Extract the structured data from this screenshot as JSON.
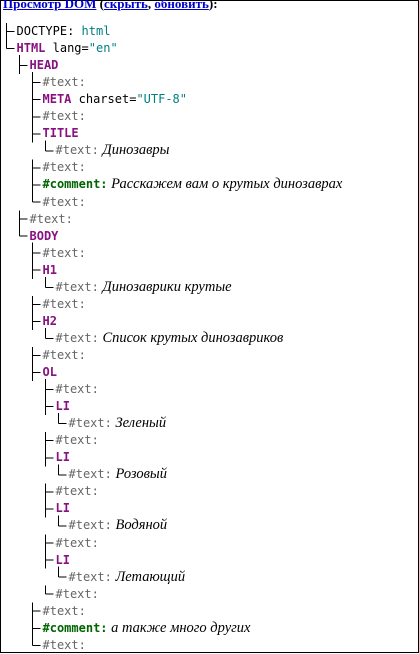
{
  "header": {
    "title": "Просмотр DOM",
    "open_paren": "(",
    "hide_link": "скрыть",
    "comma": ",",
    "refresh_link": "обновить",
    "close_paren": "):"
  },
  "tree": [
    {
      "depth": 0,
      "last": false,
      "parts": [
        {
          "t": "DOCTYPE: ",
          "c": "plain"
        },
        {
          "t": "html",
          "c": "val"
        }
      ]
    },
    {
      "depth": 0,
      "last": true,
      "parts": [
        {
          "t": "HTML",
          "c": "tag"
        },
        {
          "t": " lang=",
          "c": "plain"
        },
        {
          "t": "\"en\"",
          "c": "val"
        }
      ]
    },
    {
      "depth": 1,
      "last": false,
      "parts": [
        {
          "t": "HEAD",
          "c": "tag"
        }
      ]
    },
    {
      "depth": 2,
      "last": false,
      "parts": [
        {
          "t": "#text:",
          "c": "txt"
        }
      ]
    },
    {
      "depth": 2,
      "last": false,
      "parts": [
        {
          "t": "META",
          "c": "tag"
        },
        {
          "t": " charset=",
          "c": "plain"
        },
        {
          "t": "\"UTF-8\"",
          "c": "val"
        }
      ]
    },
    {
      "depth": 2,
      "last": false,
      "parts": [
        {
          "t": "#text:",
          "c": "txt"
        }
      ]
    },
    {
      "depth": 2,
      "last": false,
      "parts": [
        {
          "t": "TITLE",
          "c": "tag"
        }
      ]
    },
    {
      "depth": 3,
      "last": true,
      "parts": [
        {
          "t": "#text:",
          "c": "txt"
        },
        {
          "t": " Динозавры",
          "c": "italic"
        }
      ]
    },
    {
      "depth": 2,
      "last": false,
      "parts": [
        {
          "t": "#text:",
          "c": "txt"
        }
      ]
    },
    {
      "depth": 2,
      "last": false,
      "parts": [
        {
          "t": "#comment:",
          "c": "cmt"
        },
        {
          "t": "  Расскажем вам о крутых динозаврах",
          "c": "italic"
        }
      ]
    },
    {
      "depth": 2,
      "last": true,
      "parts": [
        {
          "t": "#text:",
          "c": "txt"
        }
      ]
    },
    {
      "depth": 1,
      "last": false,
      "parts": [
        {
          "t": "#text:",
          "c": "txt"
        }
      ]
    },
    {
      "depth": 1,
      "last": true,
      "parts": [
        {
          "t": "BODY",
          "c": "tag"
        }
      ]
    },
    {
      "depth": 2,
      "last": false,
      "parts": [
        {
          "t": "#text:",
          "c": "txt"
        }
      ]
    },
    {
      "depth": 2,
      "last": false,
      "parts": [
        {
          "t": "H1",
          "c": "tag"
        }
      ]
    },
    {
      "depth": 3,
      "last": true,
      "parts": [
        {
          "t": "#text:",
          "c": "txt"
        },
        {
          "t": " Динозаврики крутые",
          "c": "italic"
        }
      ]
    },
    {
      "depth": 2,
      "last": false,
      "parts": [
        {
          "t": "#text:",
          "c": "txt"
        }
      ]
    },
    {
      "depth": 2,
      "last": false,
      "parts": [
        {
          "t": "H2",
          "c": "tag"
        }
      ]
    },
    {
      "depth": 3,
      "last": true,
      "parts": [
        {
          "t": "#text:",
          "c": "txt"
        },
        {
          "t": " Список крутых динозавриков",
          "c": "italic"
        }
      ]
    },
    {
      "depth": 2,
      "last": false,
      "parts": [
        {
          "t": "#text:",
          "c": "txt"
        }
      ]
    },
    {
      "depth": 2,
      "last": false,
      "parts": [
        {
          "t": "OL",
          "c": "tag"
        }
      ]
    },
    {
      "depth": 3,
      "last": false,
      "parts": [
        {
          "t": "#text:",
          "c": "txt"
        }
      ]
    },
    {
      "depth": 3,
      "last": false,
      "parts": [
        {
          "t": "LI",
          "c": "tag"
        }
      ]
    },
    {
      "depth": 4,
      "last": true,
      "parts": [
        {
          "t": "#text:",
          "c": "txt"
        },
        {
          "t": " Зеленый",
          "c": "italic"
        }
      ]
    },
    {
      "depth": 3,
      "last": false,
      "parts": [
        {
          "t": "#text:",
          "c": "txt"
        }
      ]
    },
    {
      "depth": 3,
      "last": false,
      "parts": [
        {
          "t": "LI",
          "c": "tag"
        }
      ]
    },
    {
      "depth": 4,
      "last": true,
      "parts": [
        {
          "t": "#text:",
          "c": "txt"
        },
        {
          "t": " Розовый",
          "c": "italic"
        }
      ]
    },
    {
      "depth": 3,
      "last": false,
      "parts": [
        {
          "t": "#text:",
          "c": "txt"
        }
      ]
    },
    {
      "depth": 3,
      "last": false,
      "parts": [
        {
          "t": "LI",
          "c": "tag"
        }
      ]
    },
    {
      "depth": 4,
      "last": true,
      "parts": [
        {
          "t": "#text:",
          "c": "txt"
        },
        {
          "t": " Водяной",
          "c": "italic"
        }
      ]
    },
    {
      "depth": 3,
      "last": false,
      "parts": [
        {
          "t": "#text:",
          "c": "txt"
        }
      ]
    },
    {
      "depth": 3,
      "last": false,
      "parts": [
        {
          "t": "LI",
          "c": "tag"
        }
      ]
    },
    {
      "depth": 4,
      "last": true,
      "parts": [
        {
          "t": "#text:",
          "c": "txt"
        },
        {
          "t": " Летающий",
          "c": "italic"
        }
      ]
    },
    {
      "depth": 3,
      "last": true,
      "parts": [
        {
          "t": "#text:",
          "c": "txt"
        }
      ]
    },
    {
      "depth": 2,
      "last": false,
      "parts": [
        {
          "t": "#text:",
          "c": "txt"
        }
      ]
    },
    {
      "depth": 2,
      "last": false,
      "parts": [
        {
          "t": "#comment:",
          "c": "cmt"
        },
        {
          "t": "  а также много других",
          "c": "italic"
        }
      ]
    },
    {
      "depth": 2,
      "last": true,
      "parts": [
        {
          "t": "#text:",
          "c": "txt"
        }
      ]
    }
  ],
  "colors": {
    "tag": "#881280",
    "value": "#008080",
    "text_node": "#666666",
    "comment": "#006400",
    "link": "#0000cc",
    "tree_line": "#000000"
  }
}
